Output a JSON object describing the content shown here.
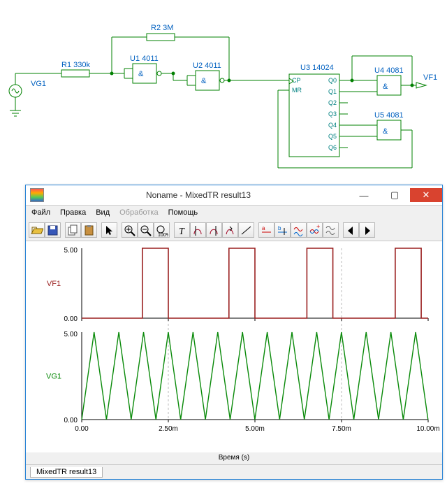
{
  "schematic": {
    "parts": {
      "vg1": "VG1",
      "r1": "R1 330k",
      "r2": "R2 3M",
      "u1": "U1 4011",
      "u2": "U2 4011",
      "u3": "U3 14024",
      "u4": "U4 4081",
      "u5": "U5 4081",
      "vf1": "VF1"
    },
    "u3_pins": {
      "cp": "CP",
      "mr": "MR",
      "q0": "Q0",
      "q1": "Q1",
      "q2": "Q2",
      "q3": "Q3",
      "q4": "Q4",
      "q5": "Q5",
      "q6": "Q6"
    },
    "gate_glyph": "&"
  },
  "window": {
    "title": "Noname - MixedTR result13",
    "buttons": {
      "min": "—",
      "max": "▢",
      "close": "✕"
    },
    "menu": [
      "Файл",
      "Правка",
      "Вид",
      "Обработка",
      "Помощь"
    ],
    "menu_disabled_index": 3,
    "status_tab": "MixedTR result13",
    "x_label": "Время (s)"
  },
  "chart_data": [
    {
      "type": "line",
      "name": "VF1",
      "title": "",
      "xlabel": "Время (s)",
      "ylabel": "VF1",
      "ylim": [
        0,
        5
      ],
      "xlim": [
        0,
        0.01
      ],
      "y_ticks": [
        0.0,
        5.0
      ],
      "x_ticks": [
        "0.00",
        "2.50m",
        "5.00m",
        "7.50m",
        "10.00m"
      ],
      "series": [
        {
          "name": "VF1",
          "color": "#9a1f1f",
          "points": [
            [
              0,
              0
            ],
            [
              0.00175,
              0
            ],
            [
              0.00175,
              5
            ],
            [
              0.0025,
              5
            ],
            [
              0.0025,
              0
            ],
            [
              0.00425,
              0
            ],
            [
              0.00425,
              5
            ],
            [
              0.005,
              5
            ],
            [
              0.005,
              0
            ],
            [
              0.0065,
              0
            ],
            [
              0.0065,
              5
            ],
            [
              0.00725,
              5
            ],
            [
              0.00725,
              0
            ],
            [
              0.00905,
              0
            ],
            [
              0.00905,
              5
            ],
            [
              0.0098,
              5
            ],
            [
              0.0098,
              0
            ],
            [
              0.01,
              0
            ]
          ]
        }
      ]
    },
    {
      "type": "line",
      "name": "VG1",
      "title": "",
      "xlabel": "Время (s)",
      "ylabel": "VG1",
      "ylim": [
        0,
        5
      ],
      "xlim": [
        0,
        0.01
      ],
      "y_ticks": [
        0.0,
        5.0
      ],
      "x_ticks": [
        "0.00",
        "2.50m",
        "5.00m",
        "7.50m",
        "10.00m"
      ],
      "series": [
        {
          "name": "VG1",
          "color": "#0a8a0a",
          "period_s": 0.000714,
          "shape": "triangle",
          "amplitude": 5
        }
      ]
    }
  ],
  "toolbar_icons": [
    "open",
    "save",
    "copy",
    "paste",
    "pointer",
    "zoom-in",
    "zoom-out",
    "zoom-1to1",
    "text-tool",
    "cursor-a",
    "cursor-b",
    "annotate",
    "line",
    "trace-a",
    "trace-b",
    "sep-curves",
    "join-curves",
    "lock",
    "prev",
    "next"
  ]
}
